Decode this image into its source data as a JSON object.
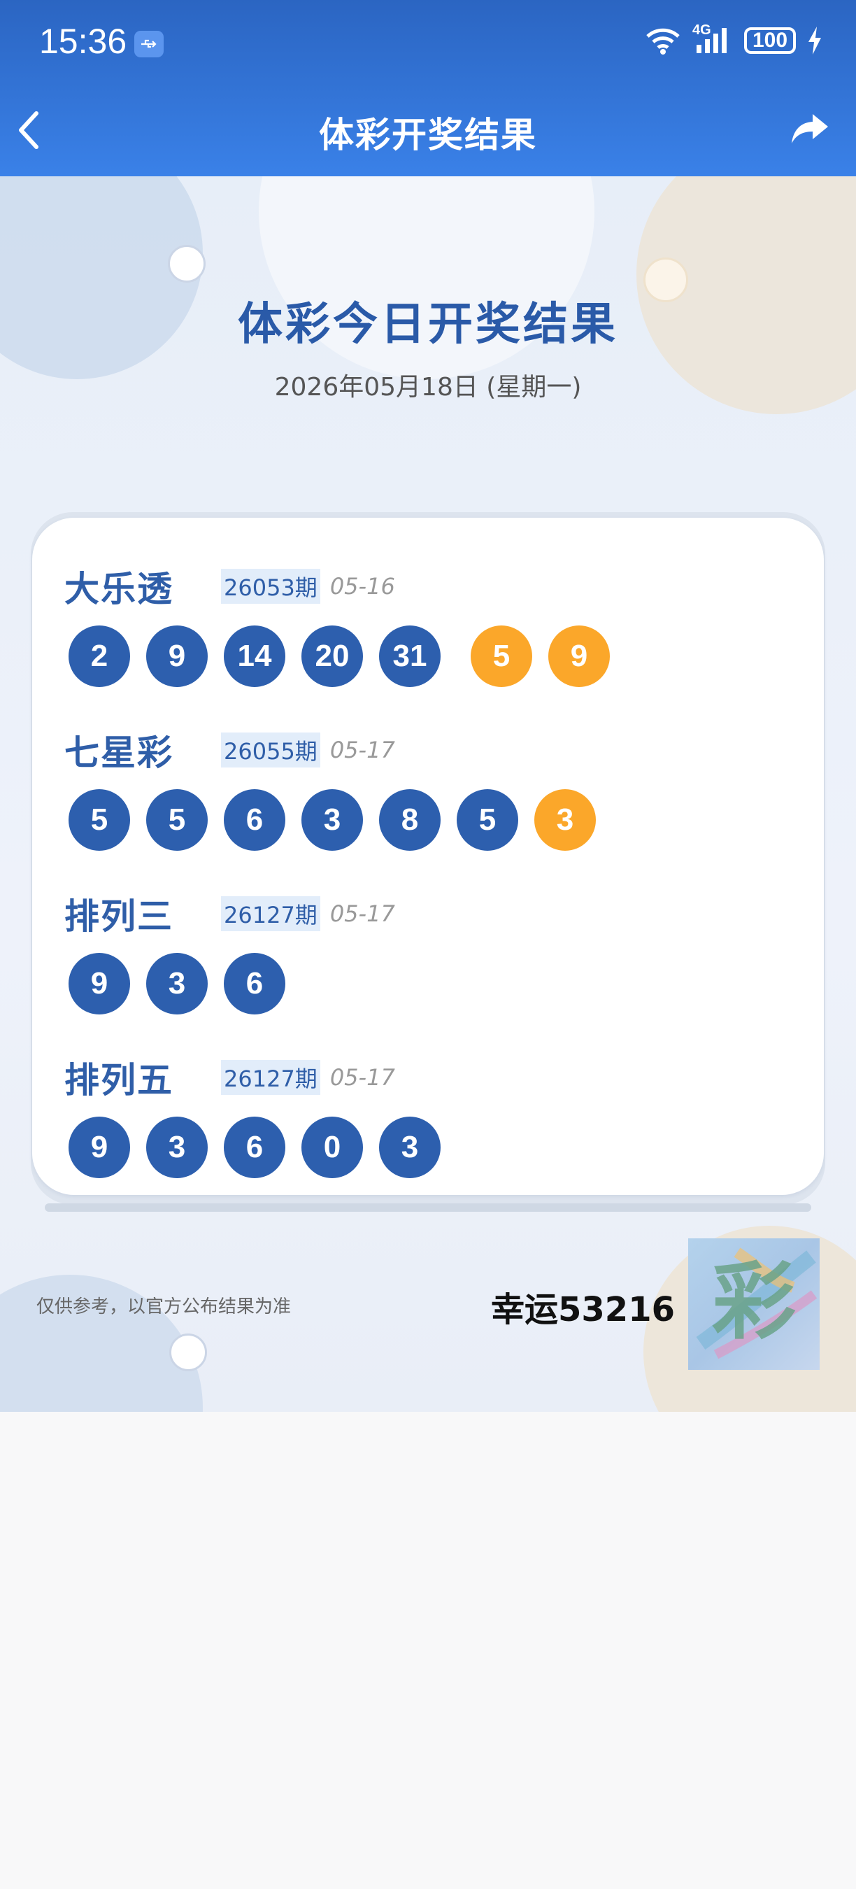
{
  "status_bar": {
    "time": "15:36",
    "network": "4G",
    "battery": "100"
  },
  "nav": {
    "title": "体彩开奖结果",
    "back_icon": "chevron-left-icon",
    "share_icon": "share-arrow-icon"
  },
  "hero": {
    "title": "体彩今日开奖结果",
    "date": "2026年05月18日 (星期一)"
  },
  "colors": {
    "primary_blue": "#2d5fae",
    "special_orange": "#fba72a",
    "header_blue": "#3a81e8"
  },
  "games": [
    {
      "name": "大乐透",
      "issue": "26053期",
      "date": "05-16",
      "main": [
        "2",
        "9",
        "14",
        "20",
        "31"
      ],
      "special": [
        "5",
        "9"
      ]
    },
    {
      "name": "七星彩",
      "issue": "26055期",
      "date": "05-17",
      "main": [
        "5",
        "5",
        "6",
        "3",
        "8",
        "5"
      ],
      "special": [
        "3"
      ]
    },
    {
      "name": "排列三",
      "issue": "26127期",
      "date": "05-17",
      "main": [
        "9",
        "3",
        "6"
      ],
      "special": []
    },
    {
      "name": "排列五",
      "issue": "26127期",
      "date": "05-17",
      "main": [
        "9",
        "3",
        "6",
        "0",
        "3"
      ],
      "special": []
    }
  ],
  "footer": {
    "disclaimer": "仅供参考，以官方公布结果为准",
    "lucky_text": "幸运53216",
    "logo_text": "彩"
  }
}
